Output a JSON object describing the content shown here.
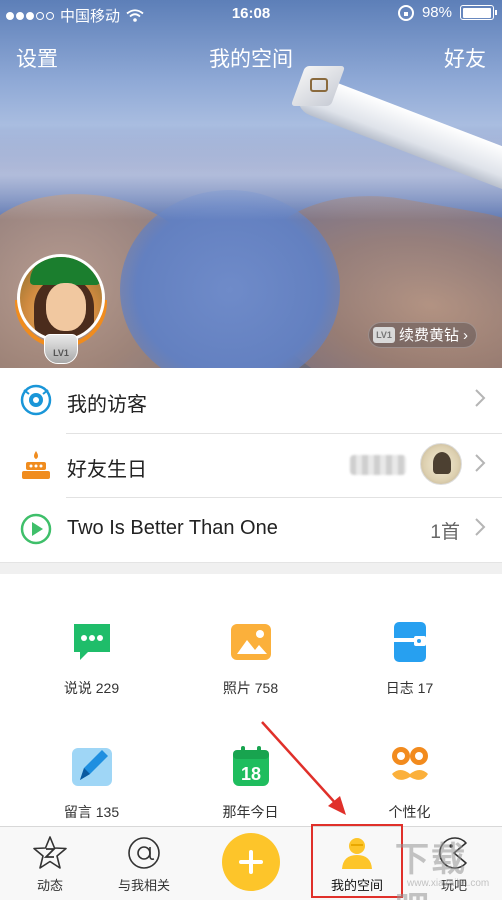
{
  "status_bar": {
    "carrier": "中国移动",
    "time": "16:08",
    "battery_text": "98%",
    "battery_level": 0.98,
    "signal_bars_on": 3,
    "signal_bars_total": 5
  },
  "nav": {
    "left_label": "设置",
    "title": "我的空间",
    "right_label": "好友"
  },
  "profile": {
    "level_badge": "LV1",
    "renew_vip_badge": "LV1",
    "renew_label": "续费黄钻"
  },
  "list": {
    "visitors_label": "我的访客",
    "birthday_label": "好友生日",
    "music_label": "Two Is Better Than One",
    "music_count": "1首"
  },
  "grid": {
    "items": [
      {
        "label": "说说 229",
        "icon": "chat-bubble-icon",
        "color": "#1fbd6a"
      },
      {
        "label": "照片 758",
        "icon": "photo-icon",
        "color": "#fbb03b"
      },
      {
        "label": "日志 17",
        "icon": "notebook-icon",
        "color": "#27a0f0"
      },
      {
        "label": "留言 135",
        "icon": "pen-icon",
        "color": "#5ab7f0"
      },
      {
        "label": "那年今日",
        "icon": "calendar-icon",
        "color": "#1fbd5e"
      },
      {
        "label": "个性化",
        "icon": "mustache-icon",
        "color": "#f28b1e"
      }
    ],
    "calendar_day": "18"
  },
  "tabs": [
    {
      "label": "动态",
      "icon": "star-z-icon"
    },
    {
      "label": "与我相关",
      "icon": "at-icon"
    },
    {
      "label": "",
      "icon": "plus-icon"
    },
    {
      "label": "我的空间",
      "icon": "user-icon"
    },
    {
      "label": "玩吧",
      "icon": "pacman-icon"
    }
  ],
  "watermark": {
    "text": "下载吧",
    "url": "www.xiazaiba.com"
  },
  "colors": {
    "accent_orange": "#f08c1e",
    "highlight_red": "#e0302a",
    "publish_yellow": "#fdc52a"
  }
}
